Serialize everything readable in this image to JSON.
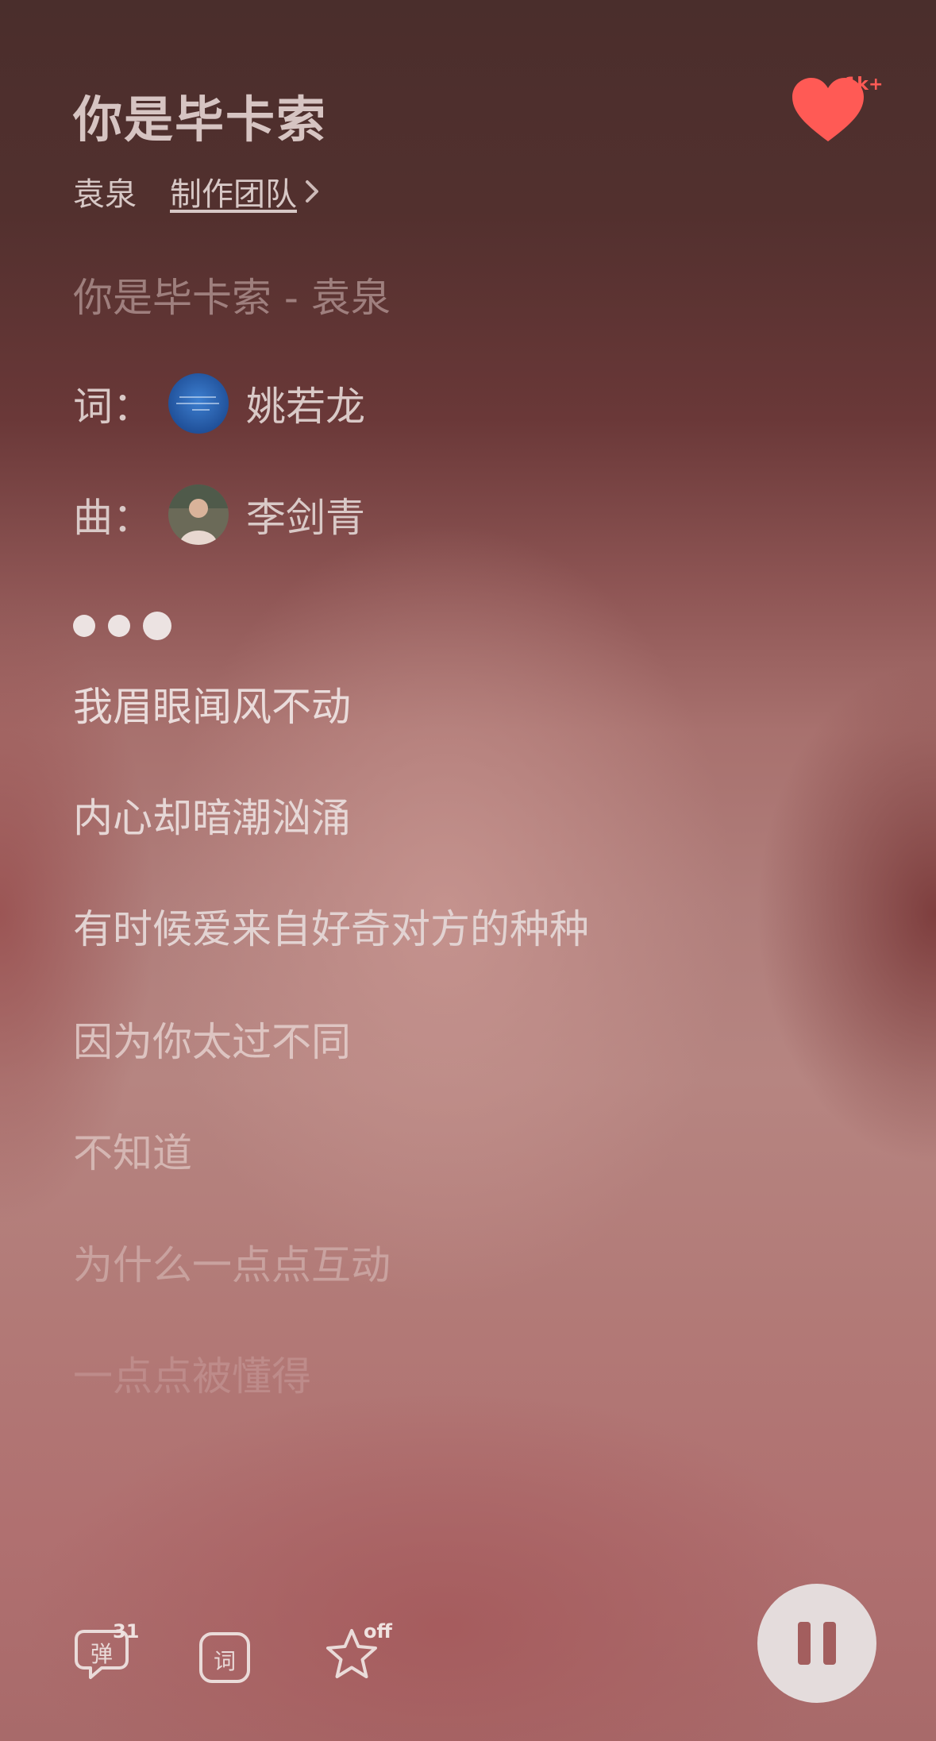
{
  "header": {
    "title": "你是毕卡索",
    "like_badge": "1k+",
    "artist": "袁泉",
    "team_link": "制作团队"
  },
  "lyrics": {
    "song_line": "你是毕卡索 - 袁泉",
    "lyricist_label": "词：",
    "lyricist_name": "姚若龙",
    "composer_label": "曲：",
    "composer_name": "李剑青",
    "lines": [
      "我眉眼闻风不动",
      "内心却暗潮汹涌",
      "有时候爱来自好奇对方的种种",
      "因为你太过不同",
      "不知道",
      "为什么一点点互动",
      "一点点被懂得"
    ]
  },
  "controls": {
    "danmaku_label": "弹",
    "danmaku_count": "31",
    "lyrics_label": "词",
    "star_badge": "off"
  },
  "colors": {
    "heart": "#ff5a55",
    "pause_button_bg": "#e4dcdc",
    "pause_bars": "#a35e5e"
  }
}
